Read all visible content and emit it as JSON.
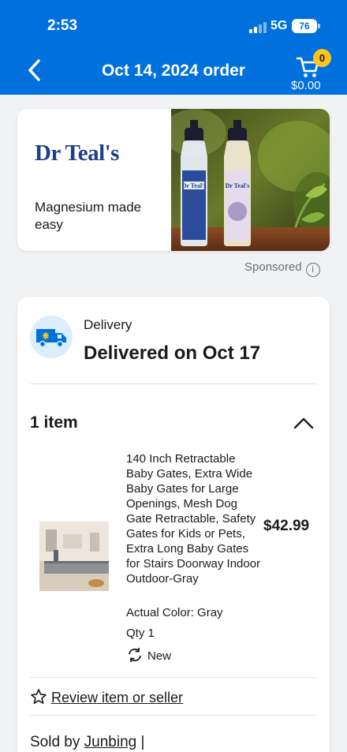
{
  "status_bar": {
    "time": "2:53",
    "network": "5G",
    "battery": "76"
  },
  "header": {
    "title": "Oct 14, 2024 order",
    "cart_count": "0",
    "cart_total": "$0.00"
  },
  "ad": {
    "brand": "Dr Teal's",
    "tagline": "Magnesium made easy",
    "bottle_label_1": "Dr Teal's",
    "bottle_label_2": "Dr Teal's",
    "sponsored_label": "Sponsored",
    "info_glyph": "i"
  },
  "delivery": {
    "label": "Delivery",
    "status": "Delivered on Oct 17"
  },
  "items": {
    "count_label": "1 item",
    "list": [
      {
        "title": "140 Inch Retractable Baby Gates, Extra Wide Baby Gates for Large Openings, Mesh Dog Gate Retractable, Safety Gates for Kids or Pets, Extra Long Baby Gates for Stairs Doorway Indoor Outdoor-Gray",
        "price": "$42.99",
        "color": "Actual Color: Gray",
        "qty": "Qty 1",
        "condition": "New"
      }
    ]
  },
  "review_label": "Review item or seller",
  "seller": {
    "prefix": "Sold by ",
    "name": "Junbing",
    "suffix": " |"
  },
  "colors": {
    "brand_blue": "#0071dc",
    "badge_yellow": "#ffc220",
    "dr_teals_navy": "#1f3f8a"
  },
  "icons": [
    "back-chevron-icon",
    "cart-icon",
    "info-icon",
    "truck-icon",
    "chevron-up-icon",
    "refresh-icon",
    "star-icon",
    "signal-icon"
  ]
}
